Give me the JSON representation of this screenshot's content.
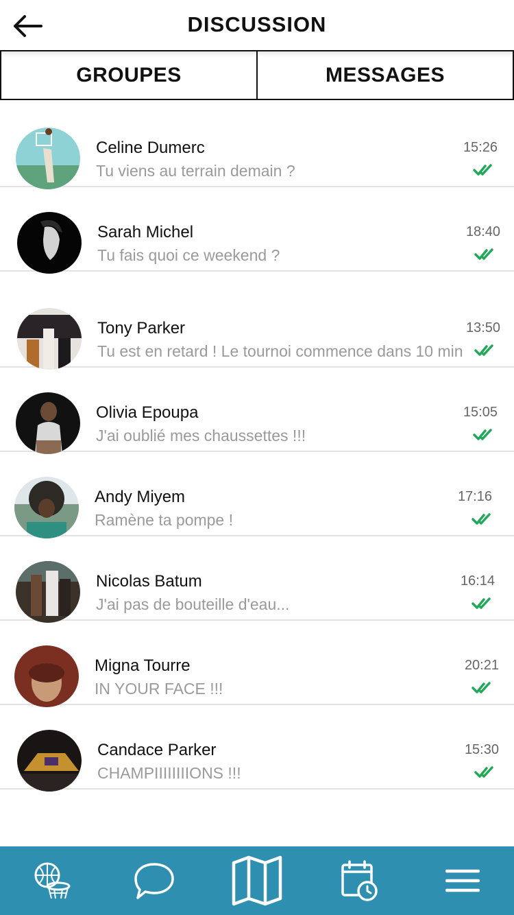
{
  "header": {
    "title": "DISCUSSION",
    "back_icon": "arrow-left-icon"
  },
  "tabs": [
    {
      "label": "GROUPES"
    },
    {
      "label": "MESSAGES"
    }
  ],
  "conversations": [
    {
      "name": "Celine Dumerc",
      "preview": "Tu viens au terrain demain ?",
      "time": "15:26",
      "status_icon": "double-check-icon",
      "avatar_colors": [
        "#8fd2d6",
        "#e9dfcf"
      ]
    },
    {
      "name": "Sarah Michel",
      "preview": "Tu fais quoi ce weekend ?",
      "time": "18:40",
      "status_icon": "double-check-icon",
      "avatar_colors": [
        "#050505",
        "#d3d3d3"
      ]
    },
    {
      "name": "Tony Parker",
      "preview": "Tu est en retard ! Le tournoi commence dans 10 min",
      "time": "13:50",
      "status_icon": "double-check-icon",
      "avatar_colors": [
        "#e6e3df",
        "#1d1a1d"
      ]
    },
    {
      "name": "Olivia Epoupa",
      "preview": "J'ai oublié mes chaussettes !!!",
      "time": "15:05",
      "status_icon": "double-check-icon",
      "avatar_colors": [
        "#111111",
        "#8a6a52"
      ]
    },
    {
      "name": "Andy Miyem",
      "preview": "Ramène ta pompe !",
      "time": "17:16",
      "status_icon": "double-check-icon",
      "avatar_colors": [
        "#7a9a85",
        "#2d2a25"
      ]
    },
    {
      "name": "Nicolas Batum",
      "preview": "J'ai pas de bouteille d'eau...",
      "time": "16:14",
      "status_icon": "double-check-icon",
      "avatar_colors": [
        "#3a3128",
        "#e8e6e4"
      ]
    },
    {
      "name": "Migna Tourre",
      "preview": "IN YOUR FACE !!!",
      "time": "20:21",
      "status_icon": "double-check-icon",
      "avatar_colors": [
        "#7a2f20",
        "#c89a77"
      ]
    },
    {
      "name": "Candace Parker",
      "preview": "CHAMPIIIIIIIIONS !!!",
      "time": "15:30",
      "status_icon": "double-check-icon",
      "avatar_colors": [
        "#1a1515",
        "#c5902e"
      ]
    }
  ],
  "bottom_nav": [
    {
      "icon": "basketball-hoop-icon"
    },
    {
      "icon": "chat-bubble-icon"
    },
    {
      "icon": "map-icon"
    },
    {
      "icon": "calendar-clock-icon"
    },
    {
      "icon": "hamburger-menu-icon"
    }
  ],
  "colors": {
    "nav_background": "#2f8fb0",
    "check_green": "#23a85a",
    "preview_gray": "#9a9a9a",
    "divider": "#e2e2e2"
  }
}
